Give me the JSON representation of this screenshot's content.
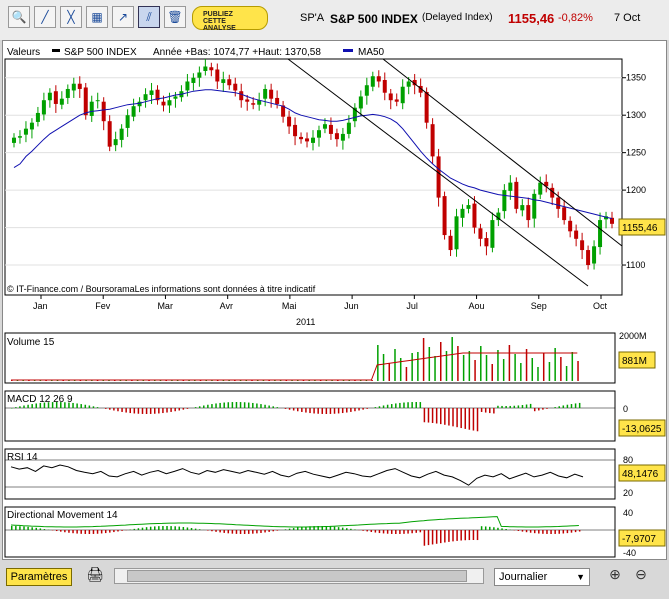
{
  "toolbar": {
    "tools": [
      {
        "name": "zoom-tool-icon",
        "glyph": "🔍"
      },
      {
        "name": "draw-line-icon",
        "glyph": "╱"
      },
      {
        "name": "draw-segment-icon",
        "glyph": "╳"
      },
      {
        "name": "indicator-icon",
        "glyph": "▦"
      },
      {
        "name": "trend-icon",
        "glyph": "↗"
      },
      {
        "name": "channel-icon",
        "glyph": "⫽"
      },
      {
        "name": "trash-icon",
        "glyph": "🗑"
      }
    ],
    "ad_lines": [
      "PUBLIEZ",
      "CETTE",
      "ANALYSE"
    ]
  },
  "header": {
    "code": "SP'A",
    "name": "S&P 500 INDEX",
    "delay": "(Delayed Index)",
    "price": "1155,46",
    "change": "-0,82%",
    "date": "7 Oct"
  },
  "chart_data": [
    {
      "type": "candlestick",
      "legend": {
        "label": "Valeurs",
        "series": "S&P 500 INDEX",
        "stats": "Année +Bas: 1074,77 +Haut: 1370,58",
        "ma": "MA50"
      },
      "colors": {
        "up": "#00a000",
        "down": "#c00000",
        "ma": "#1010b0",
        "channel": "#000000"
      },
      "y_ticks": [
        1100,
        1150,
        1200,
        1250,
        1300,
        1350
      ],
      "y_tick_labels": [
        "1100",
        "",
        "1200",
        "1250",
        "1300",
        "1350"
      ],
      "ylim": [
        1060,
        1375
      ],
      "x_labels": [
        "Jan",
        "Fev",
        "Mar",
        "Avr",
        "Mai",
        "Jun",
        "Jul",
        "Aou",
        "Sep",
        "Oct"
      ],
      "year": "2011",
      "current_value": "1155,46",
      "close_points": [
        1270,
        1272,
        1282,
        1290,
        1303,
        1320,
        1330,
        1315,
        1322,
        1335,
        1342,
        1335,
        1300,
        1318,
        1320,
        1292,
        1258,
        1268,
        1282,
        1300,
        1312,
        1318,
        1328,
        1333,
        1320,
        1313,
        1320,
        1325,
        1332,
        1345,
        1350,
        1357,
        1365,
        1360,
        1345,
        1348,
        1340,
        1333,
        1320,
        1318,
        1314,
        1320,
        1335,
        1322,
        1315,
        1298,
        1285,
        1272,
        1268,
        1265,
        1270,
        1280,
        1288,
        1275,
        1268,
        1275,
        1290,
        1310,
        1325,
        1340,
        1352,
        1345,
        1330,
        1320,
        1318,
        1338,
        1345,
        1340,
        1330,
        1290,
        1245,
        1190,
        1140,
        1120,
        1165,
        1175,
        1180,
        1150,
        1135,
        1125,
        1160,
        1170,
        1200,
        1210,
        1175,
        1180,
        1160,
        1195,
        1210,
        1205,
        1190,
        1175,
        1160,
        1145,
        1135,
        1120,
        1100,
        1125,
        1160,
        1165,
        1155
      ],
      "ma_points": [
        1230,
        1235,
        1245,
        1252,
        1260,
        1268,
        1275,
        1280,
        1285,
        1290,
        1295,
        1300,
        1303,
        1305,
        1306,
        1307,
        1308,
        1310,
        1312,
        1314,
        1315,
        1316,
        1318,
        1320,
        1322,
        1323,
        1325,
        1327,
        1328,
        1330,
        1332,
        1333,
        1334,
        1334,
        1333,
        1332,
        1331,
        1330,
        1328,
        1325,
        1322,
        1320,
        1318,
        1316,
        1314,
        1312,
        1308,
        1303,
        1300,
        1298,
        1296,
        1294,
        1293,
        1292,
        1292,
        1293,
        1295,
        1297,
        1299,
        1300,
        1301,
        1300,
        1298,
        1295,
        1290,
        1282,
        1272,
        1262,
        1252,
        1243,
        1235,
        1228,
        1222,
        1216,
        1212,
        1208,
        1205,
        1203,
        1200,
        1198,
        1196,
        1194,
        1193,
        1192,
        1191,
        1190,
        1189,
        1187,
        1186,
        1184,
        1182,
        1180,
        1178,
        1176,
        1174,
        1172,
        1170,
        1168,
        1166,
        1164,
        1162
      ]
    },
    {
      "type": "bar",
      "title": "Volume 15",
      "y_tick_labels": [
        "2000M"
      ],
      "current_value": "881M",
      "colors": {
        "up": "#00a000",
        "down": "#c00000",
        "ma": "#c00000"
      }
    },
    {
      "type": "bar",
      "title": "MACD 12 26 9",
      "y_tick_labels": [
        "0"
      ],
      "current_value": "-13,0625",
      "colors": {
        "up": "#00a000",
        "down": "#c00000"
      }
    },
    {
      "type": "line",
      "title": "RSI 14",
      "y_tick_labels": [
        "80",
        "20"
      ],
      "current_value": "48,1476",
      "colors": {
        "line": "#000000"
      },
      "values": [
        70,
        65,
        68,
        60,
        72,
        68,
        74,
        70,
        62,
        58,
        55,
        60,
        50,
        48,
        55,
        60,
        52,
        58,
        62,
        55,
        60,
        66,
        58,
        54,
        62,
        58,
        64,
        60,
        56,
        62,
        58,
        54,
        60,
        52,
        48,
        56,
        60,
        54,
        50,
        46,
        52,
        58,
        55,
        50,
        48,
        55,
        62,
        66,
        58,
        50,
        46,
        54,
        60,
        52,
        48,
        40,
        30,
        45,
        52,
        48,
        55,
        44,
        50,
        56,
        48,
        52,
        58,
        50,
        46,
        54,
        48
      ]
    },
    {
      "type": "bar",
      "title": "Directional Movement 14",
      "y_tick_labels": [
        "40",
        "-40"
      ],
      "current_value": "-7,9707",
      "colors": {
        "up": "#00a000",
        "down": "#c00000",
        "line": "#00a000"
      }
    }
  ],
  "footer": {
    "params_label": "Paramètres",
    "print_glyph": "🖨",
    "view_select": "Journalier",
    "zoom_in_glyph": "⊕",
    "zoom_out_glyph": "⊖",
    "credit": "© IT-Finance.com / BoursoramaLes informations sont données à titre indicatif"
  }
}
